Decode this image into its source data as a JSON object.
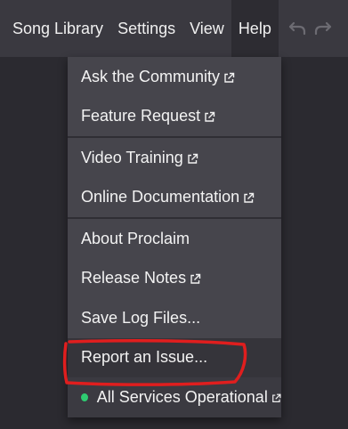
{
  "menubar": {
    "items": [
      {
        "label": "Song Library"
      },
      {
        "label": "Settings"
      },
      {
        "label": "View"
      },
      {
        "label": "Help",
        "active": true
      }
    ],
    "undo_icon": "undo-icon",
    "redo_icon": "redo-icon"
  },
  "help_menu": {
    "groups": [
      {
        "items": [
          {
            "label": "Ask the Community",
            "external": true
          },
          {
            "label": "Feature Request",
            "external": true
          }
        ]
      },
      {
        "items": [
          {
            "label": "Video Training",
            "external": true
          },
          {
            "label": "Online Documentation",
            "external": true
          }
        ]
      },
      {
        "items": [
          {
            "label": "About Proclaim",
            "external": false
          },
          {
            "label": "Release Notes",
            "external": true
          },
          {
            "label": "Save Log Files...",
            "external": false
          },
          {
            "label": "Report an Issue...",
            "external": false,
            "highlighted": true
          }
        ]
      }
    ],
    "status": {
      "label": "All Services Operational",
      "external": true,
      "indicator_color": "#2ecc71"
    }
  },
  "colors": {
    "menubar_bg": "#3a3940",
    "menu_bg": "#46454c",
    "annotation_red": "#e01e1e",
    "status_green": "#2ecc71"
  }
}
